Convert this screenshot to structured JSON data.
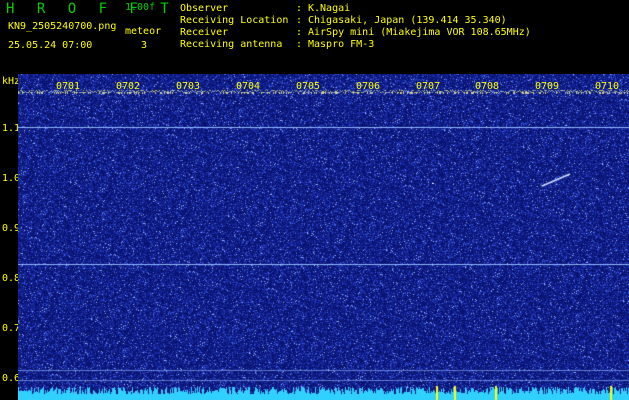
{
  "header": {
    "app_title": "H R O F F T",
    "version": "1.00f",
    "filename": "KN9_2505240700.png",
    "timestamp": "25.05.24 07:00",
    "meteor_label": "meteor",
    "meteor_count": "3"
  },
  "info": [
    {
      "key": "Observer",
      "value": "K.Nagai"
    },
    {
      "key": "Receiving Location",
      "value": "Chigasaki, Japan (139.414 35.340)"
    },
    {
      "key": "Receiver",
      "value": "AirSpy mini (Miakejima VOR 108.65MHz)"
    },
    {
      "key": "Receiving antenna",
      "value": "Maspro FM-3"
    }
  ],
  "info_separator": ":",
  "spectrogram": {
    "y_unit": "kHz",
    "y_ticks": [
      "1.1",
      "1.0",
      "0.9",
      "0.8",
      "0.7",
      "0.6"
    ],
    "x_ticks": [
      "0701",
      "0702",
      "0703",
      "0704",
      "0705",
      "0706",
      "0707",
      "0708",
      "0709",
      "0710"
    ],
    "colors": {
      "background": "#0a1470",
      "noise": "#3a55d8",
      "carrier": "#8fb8ff",
      "top_band": "#c8c860",
      "bottom_band": "#30d0ff",
      "marker": "#ffff00"
    }
  }
}
